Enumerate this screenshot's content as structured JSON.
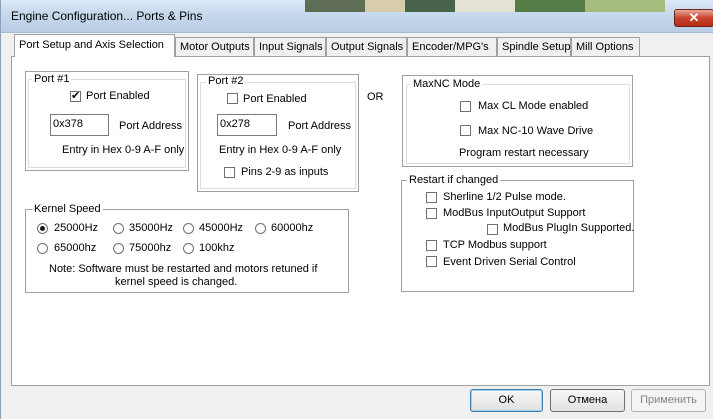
{
  "window": {
    "title": "Engine Configuration... Ports & Pins",
    "close_glyph": "✕"
  },
  "tabs": [
    {
      "label": "Port Setup and Axis Selection",
      "active": true
    },
    {
      "label": "Motor Outputs"
    },
    {
      "label": "Input Signals"
    },
    {
      "label": "Output Signals"
    },
    {
      "label": "Encoder/MPG's"
    },
    {
      "label": "Spindle Setup"
    },
    {
      "label": "Mill Options"
    }
  ],
  "port1": {
    "legend": "Port #1",
    "enabled_label": "Port Enabled",
    "enabled": true,
    "address_value": "0x378",
    "address_label": "Port Address",
    "hint": "Entry in Hex 0-9 A-F only"
  },
  "port2": {
    "legend": "Port #2",
    "enabled_label": "Port Enabled",
    "enabled": false,
    "address_value": "0x278",
    "address_label": "Port Address",
    "hint": "Entry in Hex 0-9 A-F only",
    "pins_label": "Pins 2-9 as inputs",
    "pins": false
  },
  "or_label": "OR",
  "maxnc": {
    "legend": "MaxNC Mode",
    "cl_label": "Max CL Mode enabled",
    "wave_label": "Max NC-10 Wave Drive",
    "note": "Program restart necessary"
  },
  "kernel": {
    "legend": "Kernel Speed",
    "options": [
      "25000Hz",
      "35000Hz",
      "45000Hz",
      "60000hz",
      "65000hz",
      "75000hz",
      "100khz"
    ],
    "selected": "25000Hz",
    "note_line1": "Note: Software must be restarted and motors retuned if",
    "note_line2": "kernel speed is changed."
  },
  "restart": {
    "legend": "Restart if changed",
    "sherline": "Sherline 1/2 Pulse mode.",
    "modbus_io": "ModBus InputOutput Support",
    "modbus_plugin": "ModBus PlugIn Supported.",
    "tcp": "TCP Modbus support",
    "serial": "Event Driven Serial Control"
  },
  "buttons": {
    "ok": "OK",
    "cancel": "Отмена",
    "apply": "Применить"
  },
  "colors": {
    "titlebar": "#c6d8ec",
    "close": "#c7432b",
    "tab_panel": "#ffffff"
  }
}
